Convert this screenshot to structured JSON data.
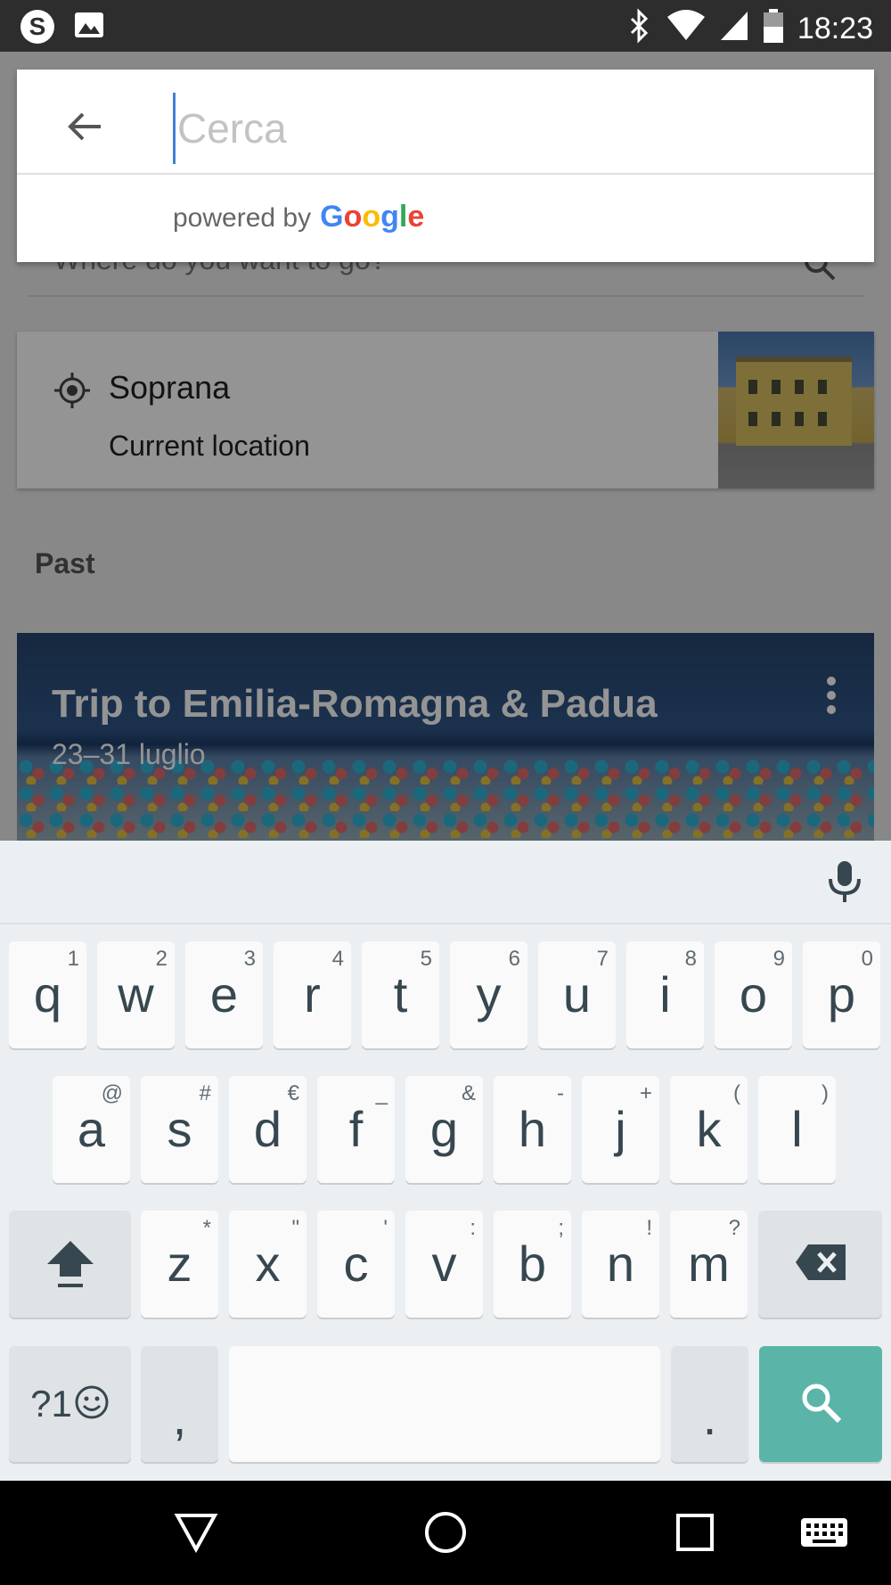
{
  "status_bar": {
    "time": "18:23",
    "left_icons": [
      "skype-icon",
      "image-icon"
    ],
    "right_icons": [
      "bluetooth-icon",
      "wifi-icon",
      "signal-icon",
      "battery-icon"
    ]
  },
  "background": {
    "search_hint": "Where do you want to go?",
    "current_location": {
      "name": "Soprana",
      "subtitle": "Current location"
    },
    "section_label": "Past",
    "trip": {
      "title": "Trip to Emilia-Romagna & Padua",
      "dates": "23–31 luglio"
    }
  },
  "search": {
    "placeholder": "Cerca",
    "value": "",
    "powered_by": "powered by",
    "google_letters": [
      {
        "ch": "G",
        "color": "#4285F4"
      },
      {
        "ch": "o",
        "color": "#EA4335"
      },
      {
        "ch": "o",
        "color": "#FBBC05"
      },
      {
        "ch": "g",
        "color": "#4285F4"
      },
      {
        "ch": "l",
        "color": "#34A853"
      },
      {
        "ch": "e",
        "color": "#EA4335"
      }
    ]
  },
  "keyboard": {
    "row1": [
      {
        "key": "q",
        "hint": "1"
      },
      {
        "key": "w",
        "hint": "2"
      },
      {
        "key": "e",
        "hint": "3"
      },
      {
        "key": "r",
        "hint": "4"
      },
      {
        "key": "t",
        "hint": "5"
      },
      {
        "key": "y",
        "hint": "6"
      },
      {
        "key": "u",
        "hint": "7"
      },
      {
        "key": "i",
        "hint": "8"
      },
      {
        "key": "o",
        "hint": "9"
      },
      {
        "key": "p",
        "hint": "0"
      }
    ],
    "row2": [
      {
        "key": "a",
        "hint": "@"
      },
      {
        "key": "s",
        "hint": "#"
      },
      {
        "key": "d",
        "hint": "€"
      },
      {
        "key": "f",
        "hint": "_"
      },
      {
        "key": "g",
        "hint": "&"
      },
      {
        "key": "h",
        "hint": "-"
      },
      {
        "key": "j",
        "hint": "+"
      },
      {
        "key": "k",
        "hint": "("
      },
      {
        "key": "l",
        "hint": ")"
      }
    ],
    "row3": [
      {
        "key": "z",
        "hint": "*"
      },
      {
        "key": "x",
        "hint": "\""
      },
      {
        "key": "c",
        "hint": "'"
      },
      {
        "key": "v",
        "hint": ":"
      },
      {
        "key": "b",
        "hint": ";"
      },
      {
        "key": "n",
        "hint": "!"
      },
      {
        "key": "m",
        "hint": "?"
      }
    ],
    "symbols_label": "?1",
    "comma": ",",
    "period": ".",
    "accent_color": "#5ab5a8"
  },
  "nav_bar": {
    "buttons": [
      "back-triangle-icon",
      "home-circle-icon",
      "recents-square-icon",
      "keyboard-icon"
    ]
  }
}
